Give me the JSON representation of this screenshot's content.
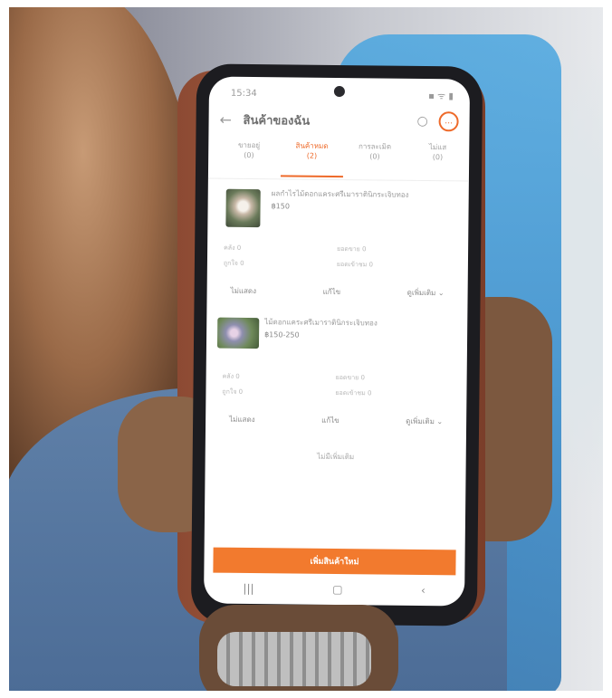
{
  "status": {
    "time": "15:34",
    "right_icons": "▪ ᯤ ▮"
  },
  "appbar": {
    "title": "สินค้าของฉัน"
  },
  "tabs": [
    {
      "label": "ขายอยู่",
      "count": "(0)"
    },
    {
      "label": "สินค้าหมด",
      "count": "(2)"
    },
    {
      "label": "การละเมิด",
      "count": "(0)"
    },
    {
      "label": "ไม่แส",
      "count": "(0)"
    }
  ],
  "products": [
    {
      "name": "ผลกำไรไม้ดอกแคระศรีเมาราตินิกระเจิบทอง",
      "price": "฿150",
      "stats": [
        "คลัง 0",
        "ยอดขาย 0",
        "ถูกใจ 0",
        "ยอดเข้าชม 0"
      ],
      "actions": [
        "ไม่แสดง",
        "แก้ไข",
        "ดูเพิ่มเติม ⌄"
      ]
    },
    {
      "name": "ไม้ดอกแคระศรีเมาราตินิกระเจิบทอง",
      "price": "฿150-250",
      "stats": [
        "คลัง 0",
        "ยอดขาย 0",
        "ถูกใจ 0",
        "ยอดเข้าชม 0"
      ],
      "actions": [
        "ไม่แสดง",
        "แก้ไข",
        "ดูเพิ่มเติม ⌄"
      ]
    }
  ],
  "no_more_text": "ไม่มีเพิ่มเติม",
  "add_button": "เพิ่มสินค้าใหม่",
  "nav": [
    "|||",
    "▢",
    "‹"
  ],
  "colors": {
    "accent": "#f27a2e"
  }
}
